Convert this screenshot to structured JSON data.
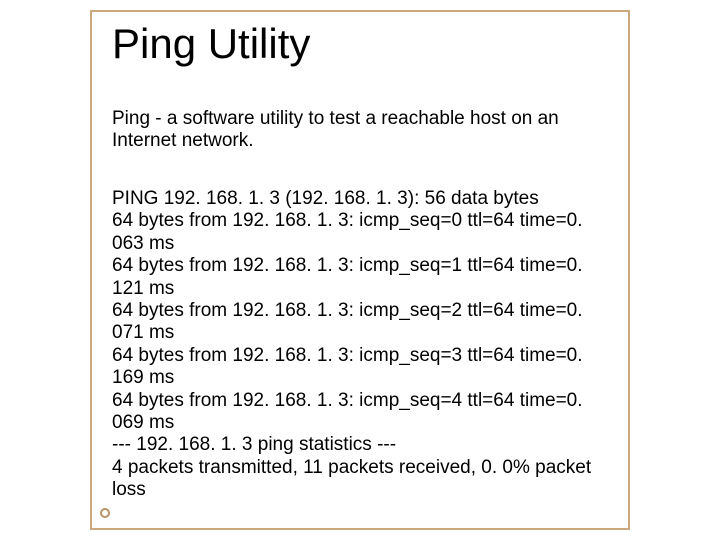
{
  "title": "Ping Utility",
  "description": "Ping - a software utility to test a reachable host on an Internet network.",
  "lines": [
    "PING 192. 168. 1. 3 (192. 168. 1. 3): 56 data bytes",
    "64 bytes from 192. 168. 1. 3: icmp_seq=0 ttl=64 time=0. 063 ms",
    "64 bytes from 192. 168. 1. 3: icmp_seq=1 ttl=64 time=0. 121 ms",
    "64 bytes from 192. 168. 1. 3: icmp_seq=2 ttl=64 time=0. 071 ms",
    "64 bytes from 192. 168. 1. 3: icmp_seq=3 ttl=64 time=0. 169 ms",
    "64 bytes from 192. 168. 1. 3: icmp_seq=4 ttl=64 time=0. 069 ms",
    "--- 192. 168. 1. 3 ping statistics ---",
    "4 packets transmitted, 11 packets received, 0. 0% packet loss"
  ]
}
